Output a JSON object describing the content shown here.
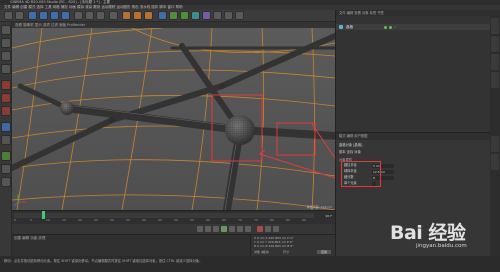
{
  "window": {
    "title": "CINEMA 4D R20.059 Studio (RC - R20) - [未标题 1 *] - 主要"
  },
  "menubar": {
    "text": "文件  编辑  创建  模式  选择  工具  网格  捕捉  动画  模拟  渲染  雕刻  运动跟踪  运动图形  角色  流水线  插件  脚本  窗口  帮助"
  },
  "viewport": {
    "header": "查看  摄像机  显示  选项  过滤  面板  ProRender",
    "status": "网格间距: 100 cm"
  },
  "timeline": {
    "ticks": [
      "0",
      "5",
      "10",
      "15",
      "20",
      "25",
      "30",
      "35",
      "40",
      "45",
      "50",
      "55",
      "60",
      "65",
      "70",
      "75",
      "80",
      "85",
      "90"
    ],
    "frame_end": "90 F"
  },
  "materials": {
    "menu": "创建  编辑  功能  纹理"
  },
  "coordinates": {
    "rows": [
      "X  0 cm     X  220.803 cm   H  0°",
      "Y  0 cm     Y  220.803 cm   P  0°",
      "Z  0 cm     Z  220.803 cm   B  0°"
    ],
    "mode_left": "对象 (相对)",
    "mode_right": "尺寸",
    "apply": "应用"
  },
  "status": {
    "text": "移动：点击并拖动鼠标移动元素。按住 SHIFT 键量化移动；节点编辑模式时按住 SHIFT 键增加选择对象；按住 CTRL 键减少选择对象。"
  },
  "objects": {
    "tabs": "文件  编辑  查看  对象  标签  书签",
    "item_name": "晶格",
    "item_tag_color": "#6fb85a"
  },
  "attributes": {
    "header": "模式  编辑  用户数据",
    "object_label": "晶格对象 [晶格]",
    "tabs": "基本  坐标  对象",
    "section": "对象属性",
    "fields": [
      {
        "label": "圆柱半径",
        "value": "5 cm"
      },
      {
        "label": "球体半径",
        "value": "12.5 cm"
      },
      {
        "label": "细分数",
        "value": "8"
      },
      {
        "label": "单个元素",
        "value": ""
      }
    ]
  },
  "watermark": {
    "brand": "Bai 经验",
    "site": "jingyan.baidu.com"
  },
  "colors": {
    "highlight": "#e23a3a",
    "wire": "#c8862a",
    "geometry": "#3c3c3c"
  }
}
